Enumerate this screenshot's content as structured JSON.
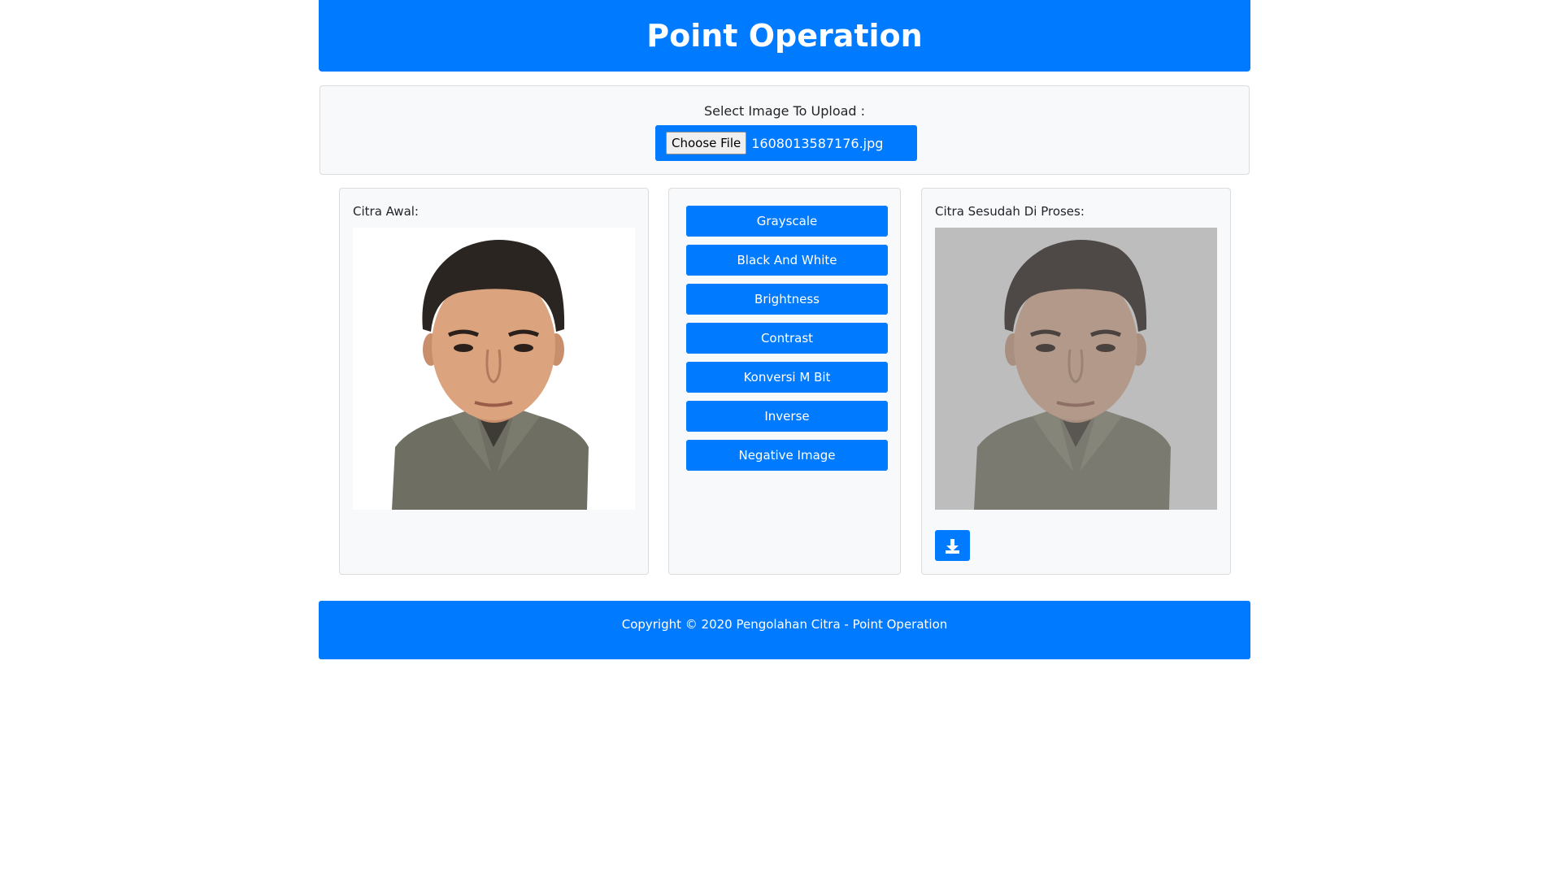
{
  "header": {
    "title": "Point Operation"
  },
  "upload": {
    "label": "Select Image To Upload :",
    "choose_button": "Choose File",
    "file_name": "1608013587176.jpg"
  },
  "original": {
    "title": "Citra Awal:"
  },
  "operations": [
    "Grayscale",
    "Black And White",
    "Brightness",
    "Contrast",
    "Konversi M Bit",
    "Inverse",
    "Negative Image"
  ],
  "processed": {
    "title": "Citra Sesudah Di Proses:",
    "download_icon": "download-icon"
  },
  "footer": {
    "text": "Copyright © 2020 Pengolahan Citra - Point Operation"
  },
  "colors": {
    "primary": "#007bff",
    "panel": "#f8f9fa",
    "processed_bg": "#bdbdbd"
  }
}
